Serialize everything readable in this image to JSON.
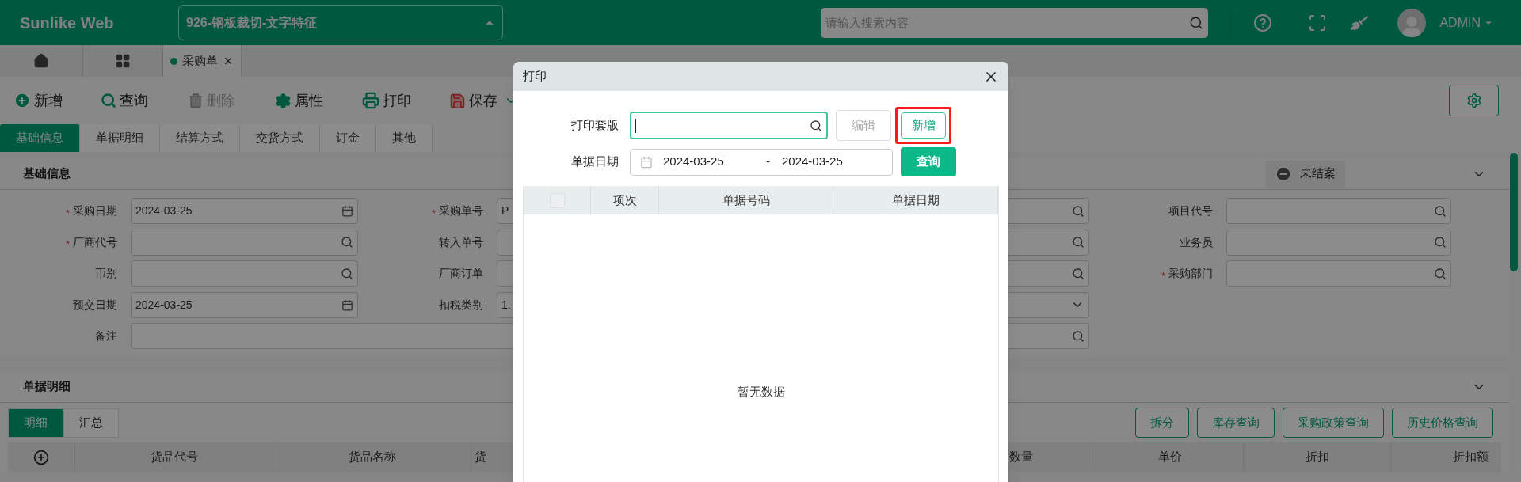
{
  "header": {
    "brand": "Sunlike Web",
    "company": "926-钢板裁切-文字特征",
    "search_placeholder": "请输入搜索内容",
    "user": "ADMIN"
  },
  "page_tabs": [
    {
      "label": "采购单",
      "selected": true
    }
  ],
  "toolbar": [
    {
      "label": "新增",
      "kind": "add",
      "disabled": false,
      "dropdown": false
    },
    {
      "label": "查询",
      "kind": "search",
      "disabled": false,
      "dropdown": false
    },
    {
      "label": "删除",
      "kind": "delete",
      "disabled": true,
      "dropdown": false
    },
    {
      "label": "属性",
      "kind": "props",
      "disabled": false,
      "dropdown": false
    },
    {
      "label": "打印",
      "kind": "print",
      "disabled": false,
      "dropdown": false
    },
    {
      "label": "保存",
      "kind": "save",
      "disabled": false,
      "dropdown": true
    }
  ],
  "section_tabs": [
    {
      "label": "基础信息",
      "selected": true
    },
    {
      "label": "单据明细",
      "selected": false
    },
    {
      "label": "结算方式",
      "selected": false
    },
    {
      "label": "交货方式",
      "selected": false
    },
    {
      "label": "订金",
      "selected": false
    },
    {
      "label": "其他",
      "selected": false
    }
  ],
  "basic_info": {
    "title": "基础信息",
    "status": "未结案",
    "rows": [
      [
        {
          "marker": "*",
          "label": "采购日期",
          "value": "2024-03-25",
          "kind": "date"
        },
        {
          "marker": "*",
          "label": "采购单号",
          "value": "P",
          "kind": "lookup"
        },
        {
          "label": "项目代号",
          "kind": "lookup"
        }
      ],
      [
        {
          "marker": "*",
          "label": "厂商代号",
          "kind": "lookup"
        },
        {
          "label": "转入单号",
          "kind": "lookup"
        },
        {
          "label": "业务员",
          "kind": "lookup"
        }
      ],
      [
        {
          "label": "币别",
          "kind": "lookup"
        },
        {
          "label": "厂商订单",
          "kind": "lookup"
        },
        {
          "marker": "*",
          "label": "采购部门",
          "kind": "lookup"
        }
      ],
      [
        {
          "label": "预交日期",
          "value": "2024-03-25",
          "kind": "date"
        },
        {
          "label": "扣税类别",
          "value": "1.",
          "kind": "select"
        }
      ],
      [
        {
          "label": "备注",
          "kind": "wide"
        }
      ]
    ]
  },
  "detail": {
    "title": "单据明细",
    "sub_tabs": [
      {
        "label": "明细",
        "selected": true
      },
      {
        "label": "汇总",
        "selected": false
      }
    ],
    "buttons": [
      "拆分",
      "库存查询",
      "采购政策查询",
      "历史价格查询"
    ],
    "columns_left": [
      "货品代号",
      "货品名称",
      "货"
    ],
    "columns_right": [
      "数量",
      "单价",
      "折扣",
      "折扣额"
    ]
  },
  "dialog": {
    "title": "打印",
    "template_label": "打印套版",
    "edit_button": {
      "label": "编辑",
      "disabled": true
    },
    "new_button": {
      "label": "新增",
      "highlighted": true
    },
    "date_label": "单据日期",
    "date_from": "2024-03-25",
    "date_separator": "-",
    "date_to": "2024-03-25",
    "query_button": "查询",
    "table": {
      "select_all": false,
      "columns": [
        "项次",
        "单据号码",
        "单据日期"
      ],
      "empty_text": "暂无数据"
    }
  }
}
